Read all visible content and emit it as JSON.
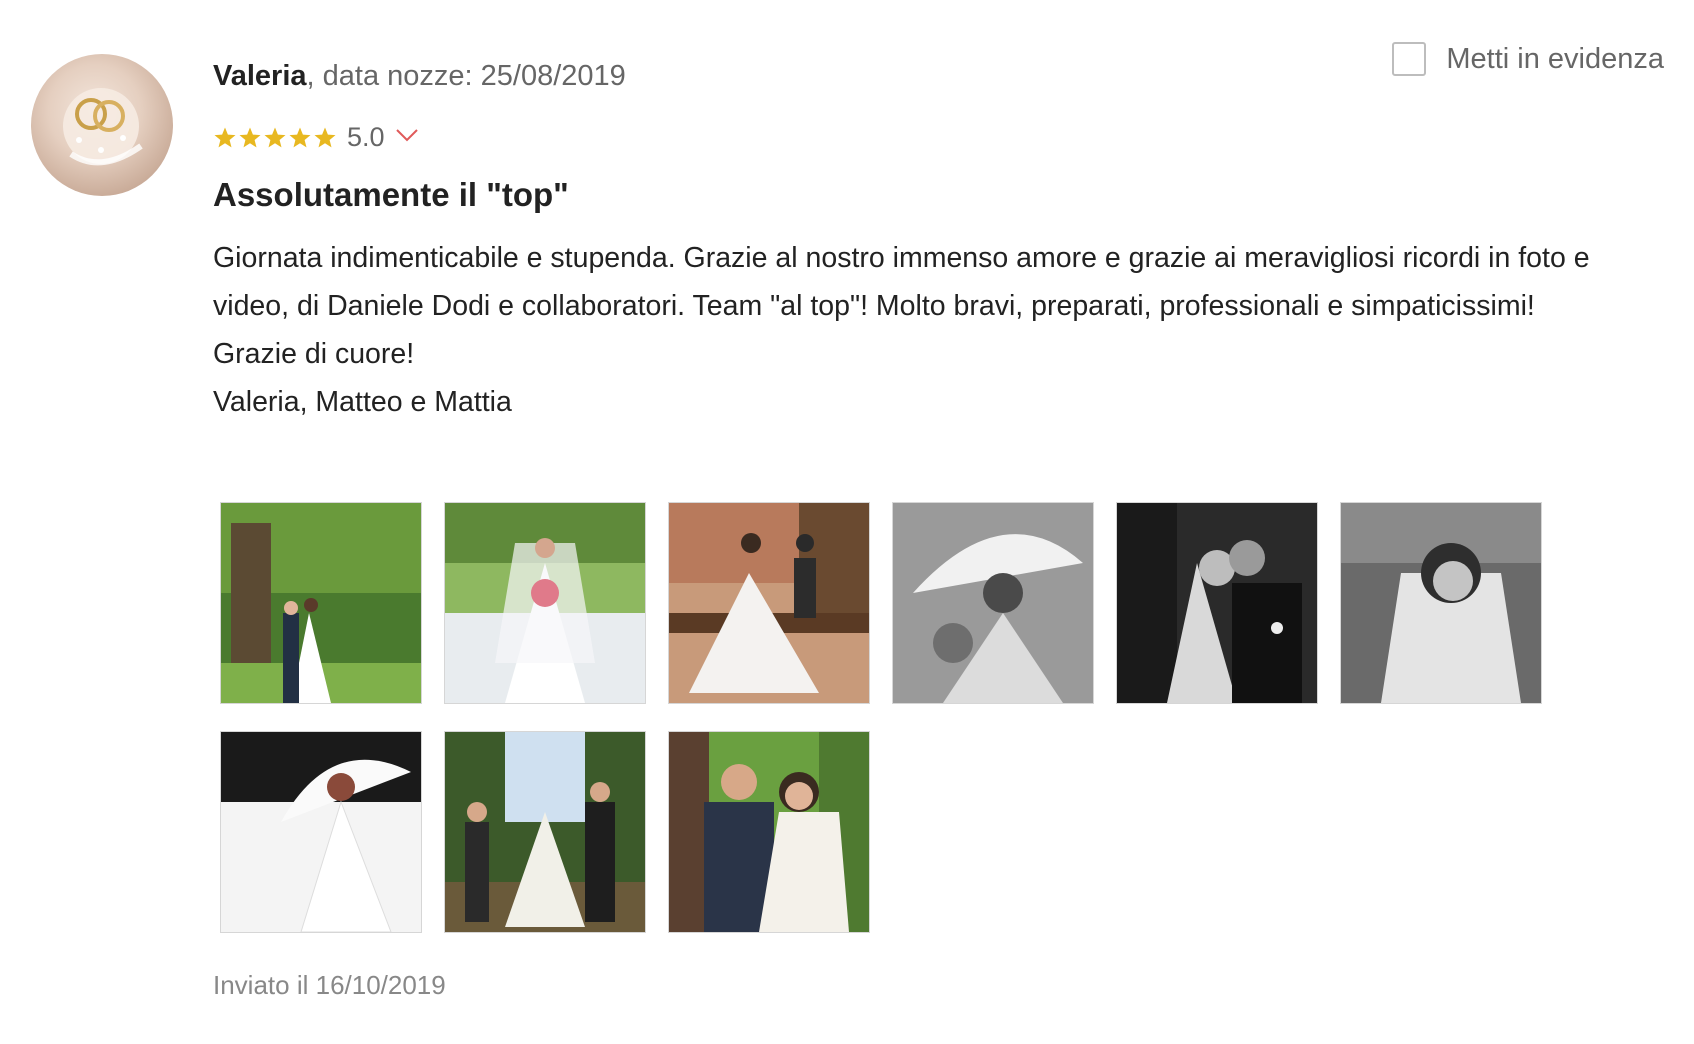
{
  "review": {
    "reviewer_name": "Valeria",
    "wedding_date_label": ", data nozze: 25/08/2019",
    "feature_label": "Metti in evidenza",
    "rating": "5.0",
    "rating_stars": 5,
    "title": "Assolutamente il \"top\"",
    "body_lines": [
      "Giornata indimenticabile e stupenda. Grazie al nostro immenso amore e grazie ai meravigliosi ricordi in foto e video, di Daniele Dodi e collaboratori. Team \"al top\"! Molto bravi, preparati, professionali e simpaticissimi!",
      "Grazie di cuore!",
      "Valeria, Matteo e Mattia"
    ],
    "sent_label": "Inviato il 16/10/2019"
  },
  "colors": {
    "star": "#e8b820",
    "chevron": "#e05a5a",
    "muted": "#666666"
  },
  "photos": [
    {
      "name": "photo-couple-forest"
    },
    {
      "name": "photo-bride-bouquet"
    },
    {
      "name": "photo-bride-groom-bench"
    },
    {
      "name": "photo-bride-umbrella-bw"
    },
    {
      "name": "photo-couple-kiss-bw"
    },
    {
      "name": "photo-bride-smiling-bw"
    },
    {
      "name": "photo-bride-umbrella"
    },
    {
      "name": "photo-family-trees"
    },
    {
      "name": "photo-couple-embrace"
    }
  ]
}
